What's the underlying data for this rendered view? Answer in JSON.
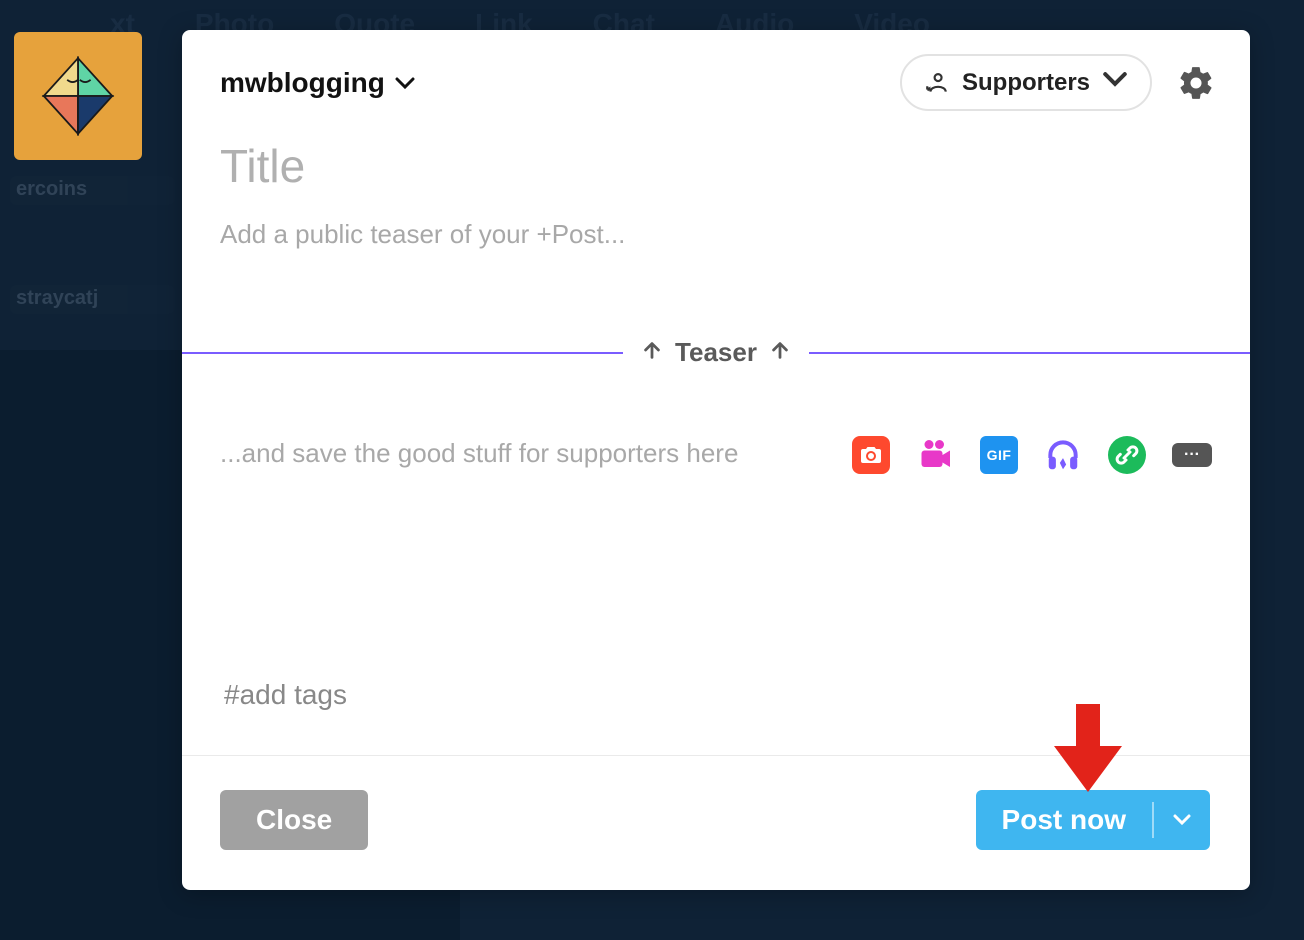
{
  "background": {
    "nav": [
      "xt",
      "Photo",
      "Quote",
      "Link",
      "Chat",
      "Audio",
      "Video"
    ],
    "sidebar_item1": "ercoins",
    "sidebar_item2": "straycatj"
  },
  "avatar": {
    "alt": "blog avatar"
  },
  "header": {
    "blog_name": "mwblogging",
    "audience_label": "Supporters"
  },
  "title": {
    "value": "",
    "placeholder": "Title"
  },
  "teaser": {
    "value": "",
    "placeholder": "Add a public teaser of your +Post..."
  },
  "divider": {
    "label": "Teaser"
  },
  "content": {
    "value": "",
    "placeholder": "...and save the good stuff for supporters here"
  },
  "media_icons": {
    "photo": "photo-icon",
    "video": "video-icon",
    "gif_label": "GIF",
    "audio": "audio-icon",
    "link": "link-icon",
    "more": "···"
  },
  "tags": {
    "value": "",
    "placeholder": "#add tags"
  },
  "footer": {
    "close_label": "Close",
    "post_label": "Post now"
  }
}
